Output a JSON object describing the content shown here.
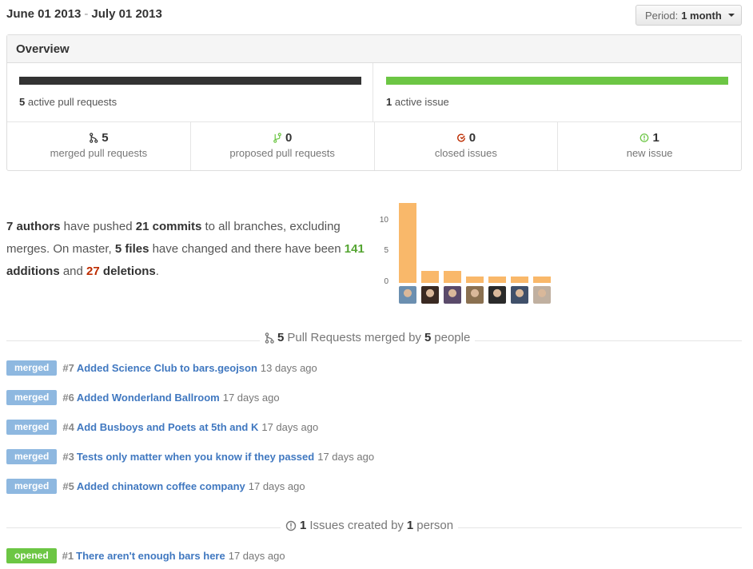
{
  "header": {
    "date_start": "June 01 2013",
    "date_sep": "-",
    "date_end": "July 01 2013",
    "period_label": "Period:",
    "period_value": "1 month"
  },
  "overview": {
    "title": "Overview",
    "active_prs_count": "5",
    "active_prs_label": "active pull requests",
    "active_issues_count": "1",
    "active_issues_label": "active issue",
    "stats": [
      {
        "icon": "merged-pr-icon",
        "count": "5",
        "label": "merged pull requests",
        "color": "#333333"
      },
      {
        "icon": "proposed-pr-icon",
        "count": "0",
        "label": "proposed pull requests",
        "color": "#6cc644"
      },
      {
        "icon": "closed-issue-icon",
        "count": "0",
        "label": "closed issues",
        "color": "#bd2c00"
      },
      {
        "icon": "new-issue-icon",
        "count": "1",
        "label": "new issue",
        "color": "#6cc644"
      }
    ]
  },
  "summary": {
    "authors": "7 authors",
    "t1": " have pushed ",
    "commits": "21 commits",
    "t2": " to all branches, excluding merges. On master, ",
    "files": "5 files",
    "t3": " have changed and there have been ",
    "additions_num": "141",
    "additions": " additions",
    "t4": " and ",
    "deletions_num": "27",
    "deletions": " deletions",
    "t5": "."
  },
  "chart_data": {
    "type": "bar",
    "categories": [
      "author-1",
      "author-2",
      "author-3",
      "author-4",
      "author-5",
      "author-6",
      "author-7"
    ],
    "values": [
      13,
      2,
      2,
      1,
      1,
      1,
      1
    ],
    "yticks": [
      "10",
      "5",
      "0"
    ],
    "ylim": [
      0,
      13
    ],
    "bar_color": "#f9b86a",
    "avatar_colors": [
      "#6b8fb0",
      "#3a2a22",
      "#5a4a6a",
      "#8a7050",
      "#2a2a2a",
      "#40506a",
      "#c0b0a0"
    ]
  },
  "pulls": {
    "title_count": "5",
    "title_mid": "Pull Requests merged by",
    "title_people": "5",
    "title_tail": "people",
    "items": [
      {
        "badge": "merged",
        "num": "#7",
        "title": "Added Science Club to bars.geojson",
        "age": "13 days ago"
      },
      {
        "badge": "merged",
        "num": "#6",
        "title": "Added Wonderland Ballroom",
        "age": "17 days ago"
      },
      {
        "badge": "merged",
        "num": "#4",
        "title": "Add Busboys and Poets at 5th and K",
        "age": "17 days ago"
      },
      {
        "badge": "merged",
        "num": "#3",
        "title": "Tests only matter when you know if they passed",
        "age": "17 days ago"
      },
      {
        "badge": "merged",
        "num": "#5",
        "title": "Added chinatown coffee company",
        "age": "17 days ago"
      }
    ]
  },
  "issues": {
    "title_count": "1",
    "title_mid": "Issues created by",
    "title_people": "1",
    "title_tail": "person",
    "items": [
      {
        "badge": "opened",
        "num": "#1",
        "title": "There aren't enough bars here",
        "age": "17 days ago"
      }
    ]
  }
}
